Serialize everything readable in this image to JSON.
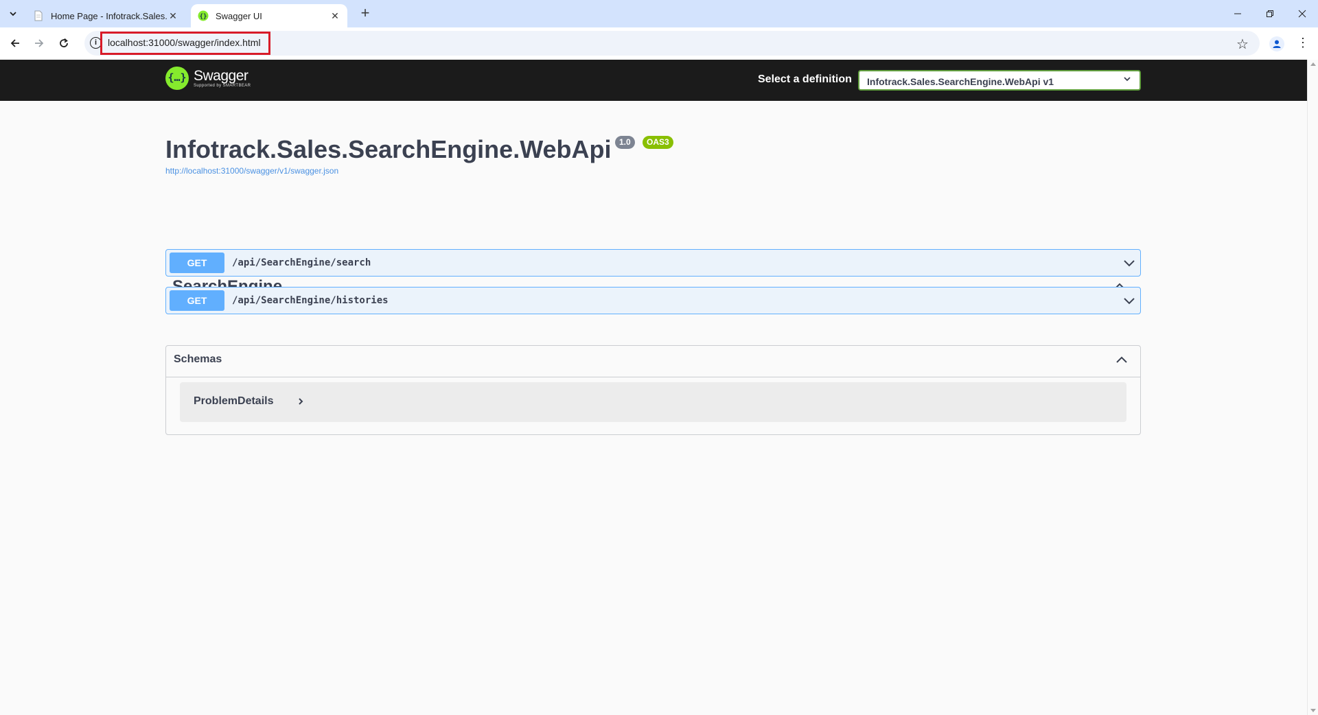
{
  "browser": {
    "tabs": [
      {
        "title": "Home Page - Infotrack.Sales.Se",
        "active": false
      },
      {
        "title": "Swagger UI",
        "active": true
      }
    ],
    "address_bar": {
      "url": "localhost:31000/swagger/index.html"
    }
  },
  "swagger": {
    "logo": {
      "name": "Swagger",
      "tagline": "Supported by SMARTBEAR"
    },
    "definition_label": "Select a definition",
    "definition_selected": "Infotrack.Sales.SearchEngine.WebApi v1",
    "info": {
      "title": "Infotrack.Sales.SearchEngine.WebApi",
      "version": "1.0",
      "oas_badge": "OAS3",
      "spec_url": "http://localhost:31000/swagger/v1/swagger.json"
    },
    "tag": {
      "name": "SearchEngine"
    },
    "operations": [
      {
        "method": "GET",
        "path": "/api/SearchEngine/search"
      },
      {
        "method": "GET",
        "path": "/api/SearchEngine/histories"
      }
    ],
    "schemas": {
      "title": "Schemas",
      "models": [
        "ProblemDetails"
      ]
    }
  },
  "colors": {
    "get_method": "#61affe",
    "topbar": "#1b1b1b",
    "logo_green": "#85ea2d",
    "oas_badge": "#89bf04",
    "url_highlight": "#d81b28"
  }
}
